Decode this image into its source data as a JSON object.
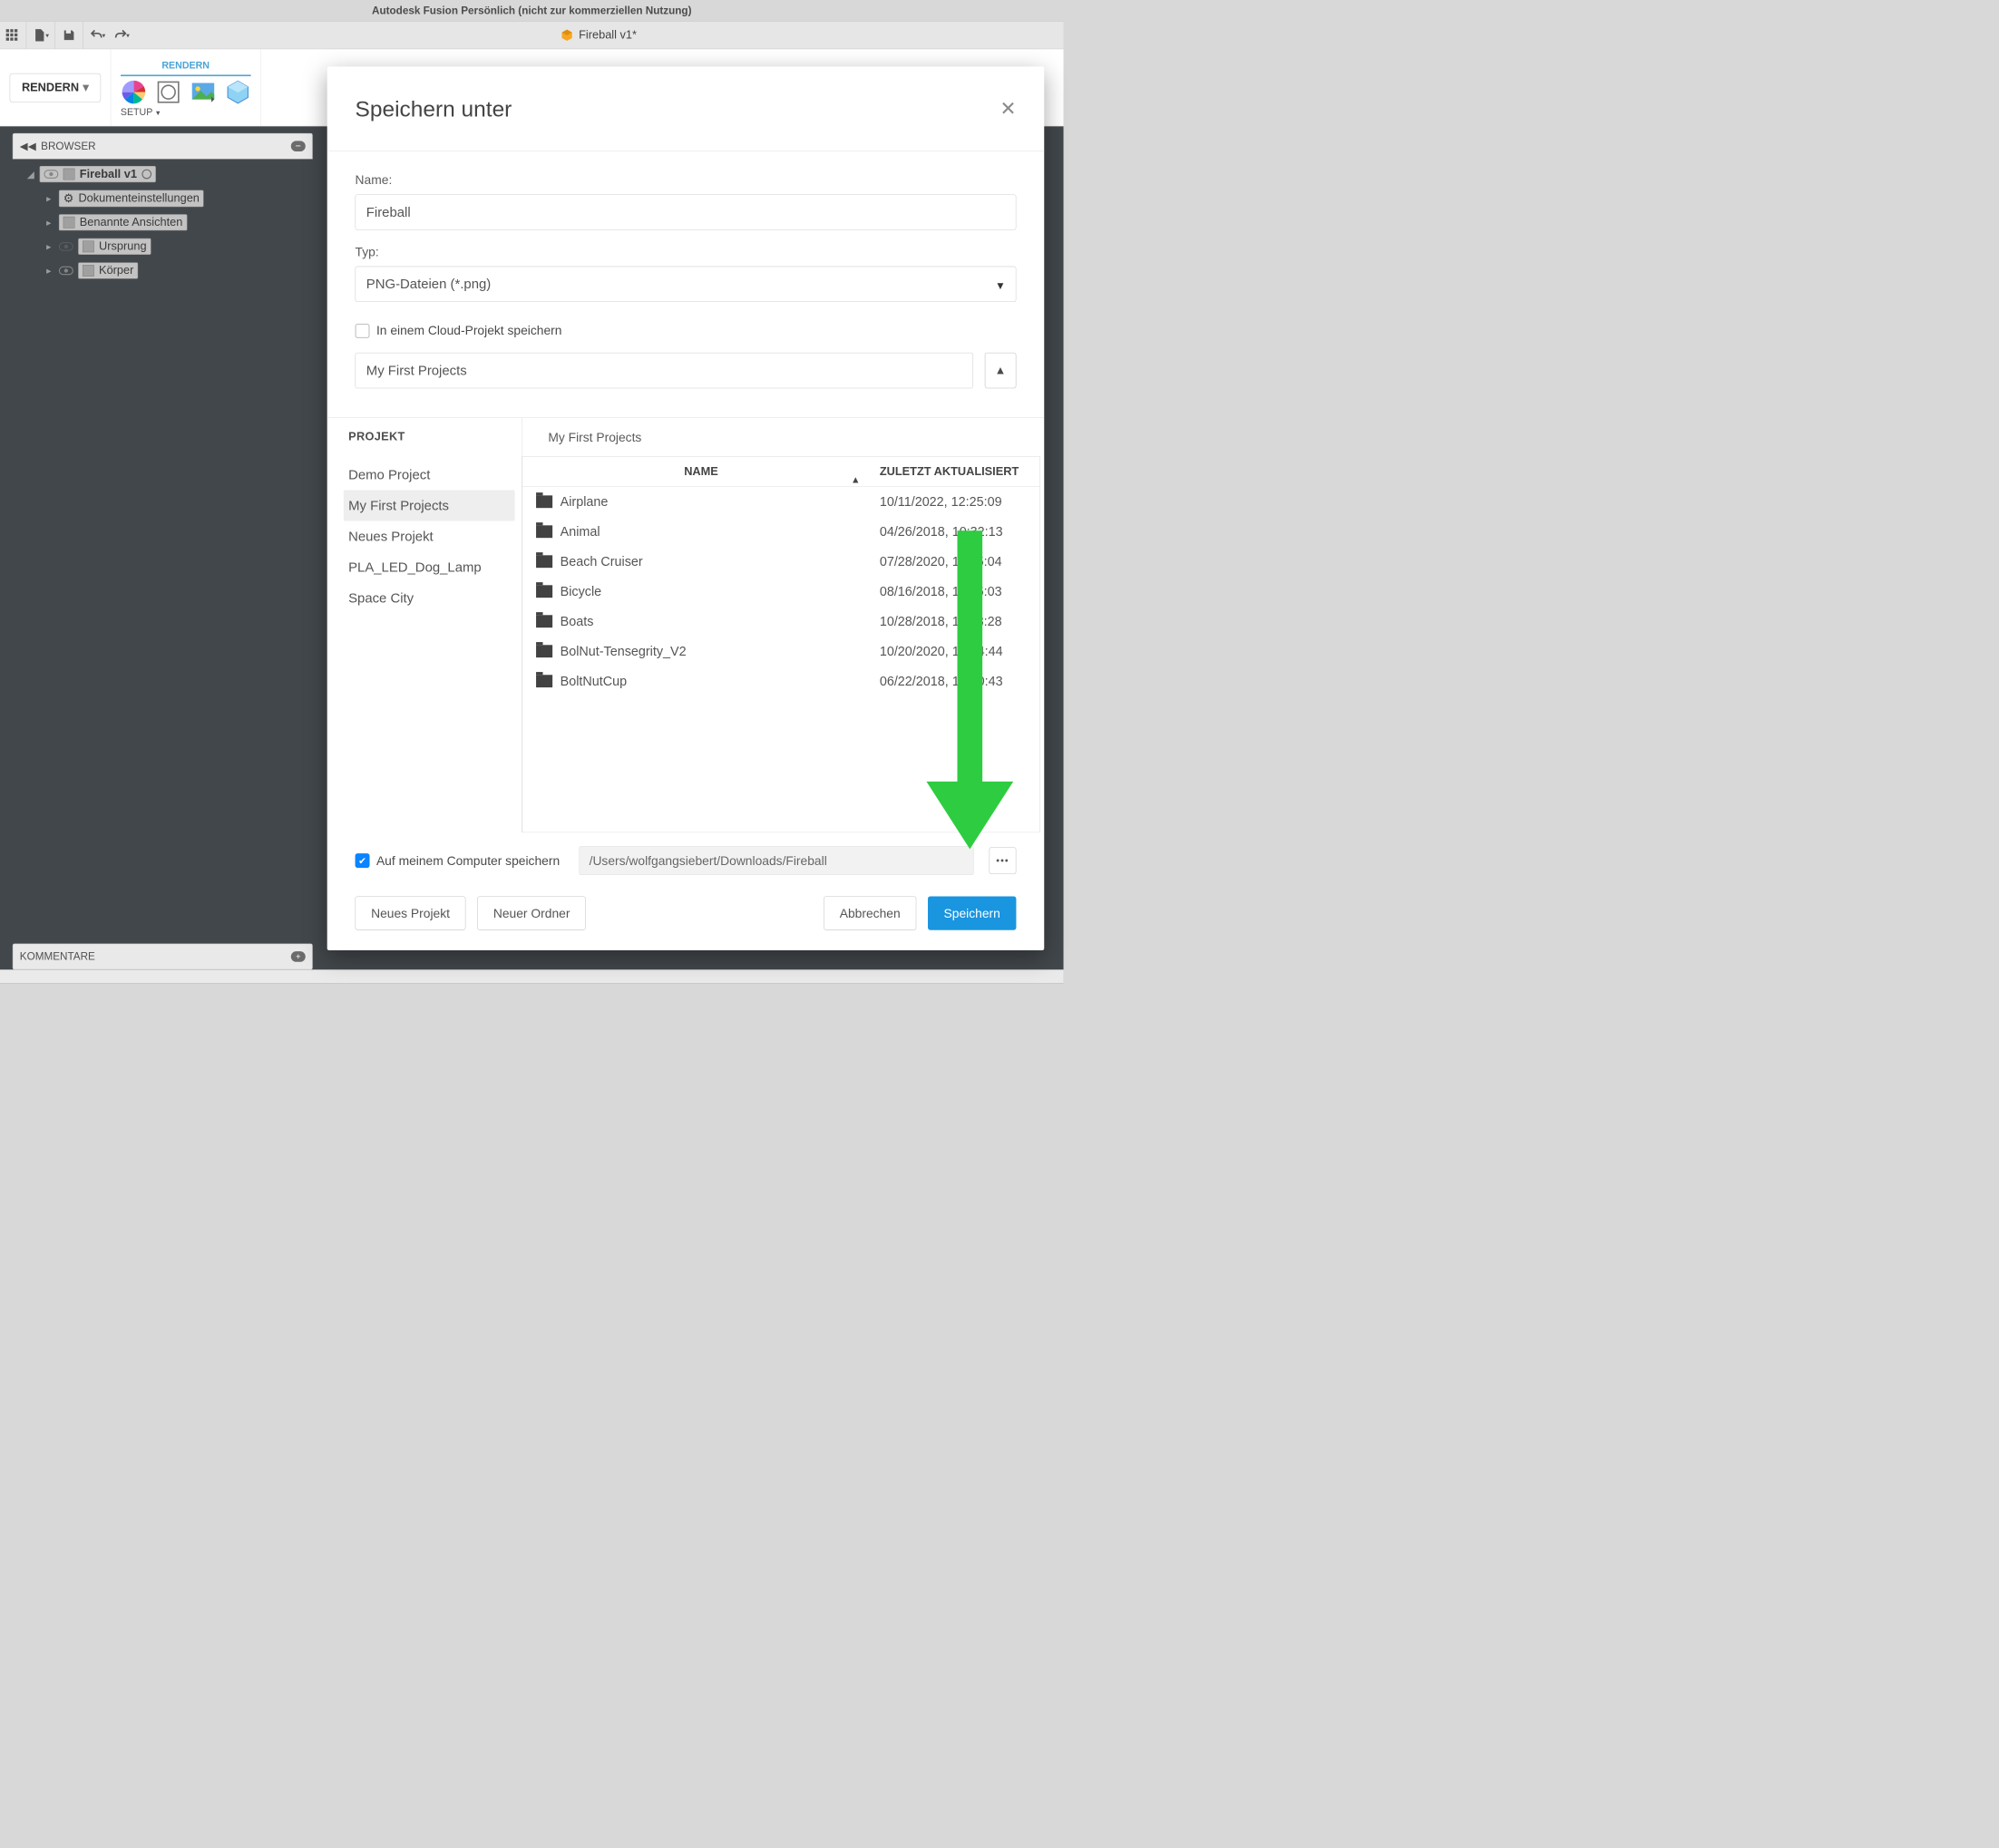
{
  "window": {
    "title": "Autodesk Fusion Persönlich (nicht zur kommerziellen Nutzung)",
    "tab_document": "Fireball v1*"
  },
  "ribbon": {
    "mode_button": "RENDERN",
    "active_tab": "RENDERN",
    "setup_label": "SETUP"
  },
  "browser": {
    "title": "BROWSER",
    "root": "Fireball v1",
    "items": [
      "Dokumenteinstellungen",
      "Benannte Ansichten",
      "Ursprung",
      "Körper"
    ]
  },
  "kommentare": {
    "title": "KOMMENTARE"
  },
  "dialog": {
    "title": "Speichern unter",
    "name_label": "Name:",
    "name_value": "Fireball",
    "type_label": "Typ:",
    "type_value": "PNG-Dateien (*.png)",
    "cloud_checkbox": "In einem Cloud-Projekt speichern",
    "cloud_project": "My First Projects",
    "project_header": "PROJEKT",
    "projects": [
      "Demo Project",
      "My First Projects",
      "Neues Projekt",
      "PLA_LED_Dog_Lamp",
      "Space City"
    ],
    "selected_project_index": 1,
    "breadcrumb": "My First Projects",
    "col_name": "NAME",
    "col_date": "ZULETZT AKTUALISIERT",
    "files": [
      {
        "name": "Airplane",
        "date": "10/11/2022, 12:25:09"
      },
      {
        "name": "Animal",
        "date": "04/26/2018, 10:32:13"
      },
      {
        "name": "Beach Cruiser",
        "date": "07/28/2020, 11:15:04"
      },
      {
        "name": "Bicycle",
        "date": "08/16/2018, 11:45:03"
      },
      {
        "name": "Boats",
        "date": "10/28/2018, 11:18:28"
      },
      {
        "name": "BolNut-Tensegrity_V2",
        "date": "10/20/2020, 12:04:44"
      },
      {
        "name": "BoltNutCup",
        "date": "06/22/2018, 13:50:43"
      }
    ],
    "save_pc_label": "Auf meinem Computer speichern",
    "save_path": "/Users/wolfgangsiebert/Downloads/Fireball",
    "btn_new_project": "Neues Projekt",
    "btn_new_folder": "Neuer Ordner",
    "btn_cancel": "Abbrechen",
    "btn_save": "Speichern"
  }
}
